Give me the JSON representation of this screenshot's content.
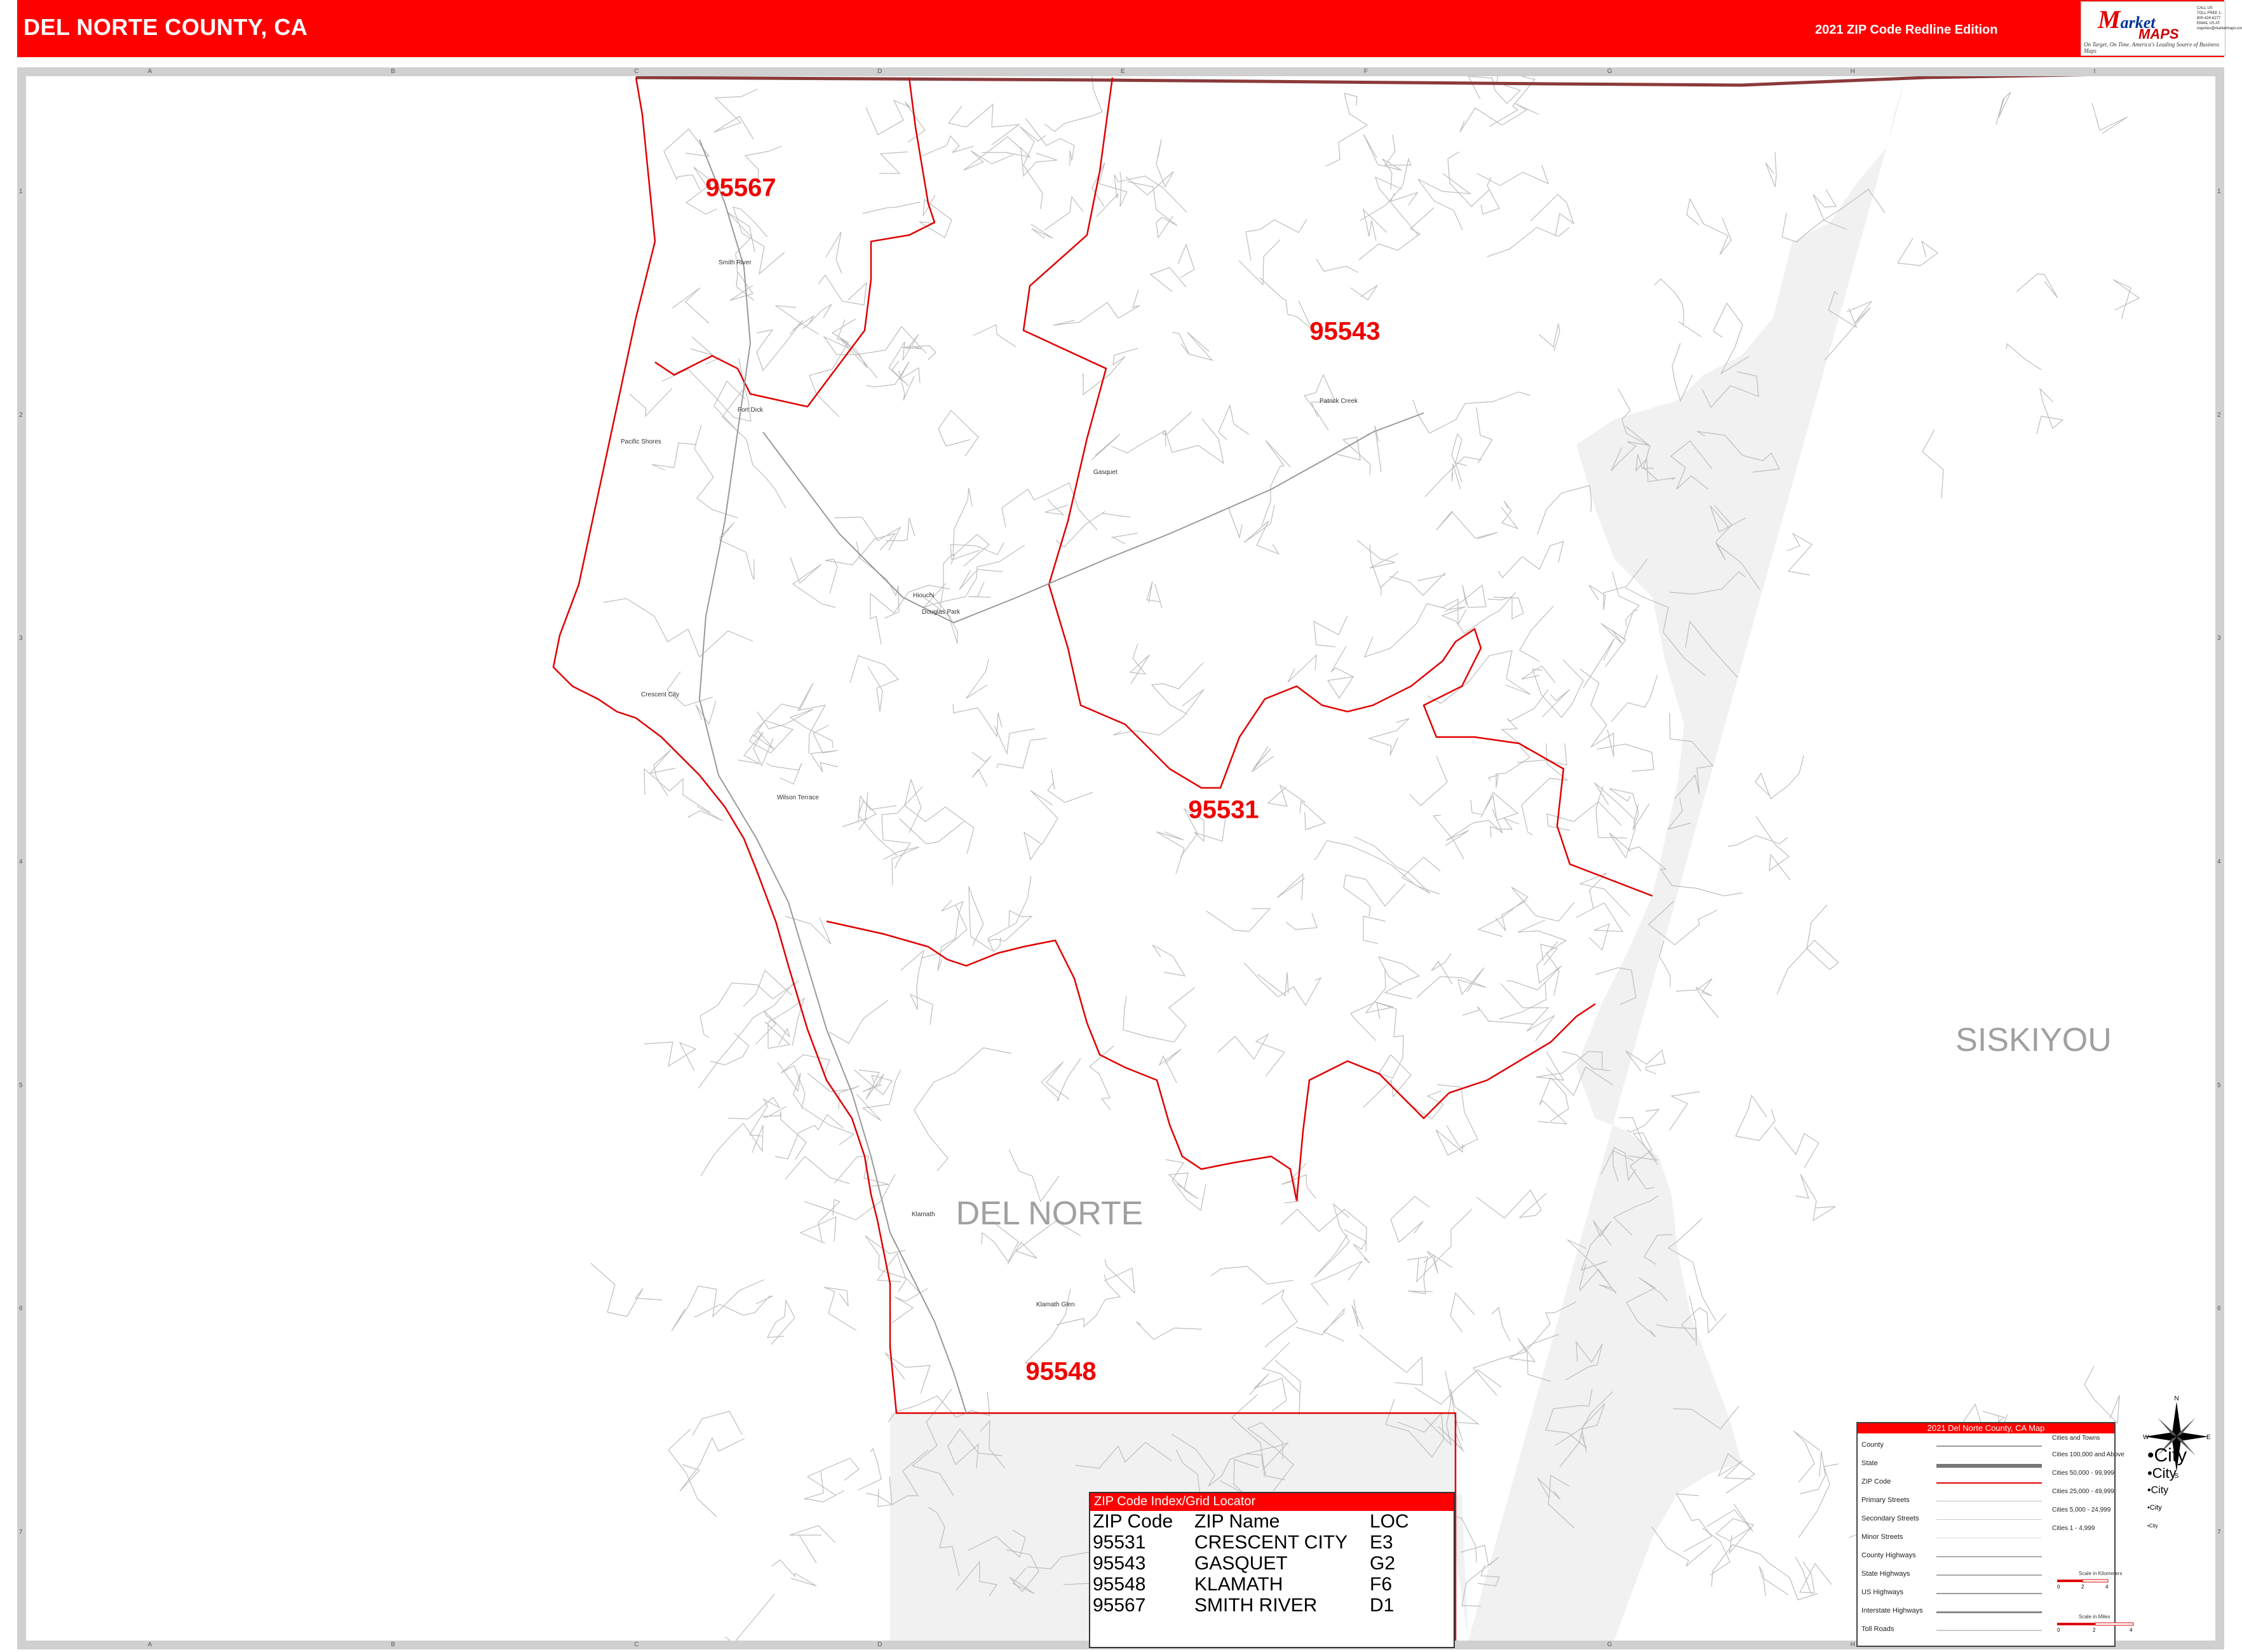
{
  "header": {
    "title": "DEL NORTE COUNTY, CA",
    "edition": "2021 ZIP Code Redline Edition"
  },
  "logo": {
    "brand_initial": "M",
    "brand_line1": "arket",
    "brand_line2": "MAPS",
    "tagline": "On Target, On Time. America's Leading Source of Business Maps",
    "contact": "CALL US TOLL FREE 1-800-424-6277 EMAIL US AT inquiries@marketmaps.com"
  },
  "grid": {
    "columns": [
      "A",
      "B",
      "C",
      "D",
      "E",
      "F",
      "G",
      "H",
      "I"
    ],
    "rows": [
      "1",
      "2",
      "3",
      "4",
      "5",
      "6",
      "7"
    ]
  },
  "zip_labels": [
    {
      "zip": "95567",
      "name": "SMITH RIVER"
    },
    {
      "zip": "95543",
      "name": "GASQUET"
    },
    {
      "zip": "95531",
      "name": "CRESCENT CITY"
    },
    {
      "zip": "95548",
      "name": "KLAMATH"
    }
  ],
  "county_labels": {
    "home": "DEL NORTE",
    "neighbor": "SISKIYOU"
  },
  "cities": [
    {
      "name": "Smith River"
    },
    {
      "name": "Fort Dick"
    },
    {
      "name": "Pacific Shores"
    },
    {
      "name": "Crescent City"
    },
    {
      "name": "Gasquet"
    },
    {
      "name": "Patrick Creek"
    },
    {
      "name": "Hiouchi"
    },
    {
      "name": "Douglas Park"
    },
    {
      "name": "Klamath"
    },
    {
      "name": "Klamath Glen"
    },
    {
      "name": "Wilson Terrace"
    }
  ],
  "zip_index": {
    "title": "ZIP Code Index/Grid Locator",
    "headers": [
      "ZIP Code",
      "ZIP Name",
      "LOC"
    ],
    "rows": [
      [
        "95531",
        "CRESCENT CITY",
        "E3"
      ],
      [
        "95543",
        "GASQUET",
        "G2"
      ],
      [
        "95548",
        "KLAMATH",
        "F6"
      ],
      [
        "95567",
        "SMITH RIVER",
        "D1"
      ]
    ]
  },
  "legend": {
    "title": "2021 Del Norte County, CA Map",
    "items": [
      "County",
      "State",
      "ZIP Code",
      "Primary Streets",
      "Secondary Streets",
      "Minor Streets",
      "County Highways",
      "State Highways",
      "US Highways",
      "Interstate Highways",
      "Toll Roads"
    ],
    "cities_heading": "Cities and Towns",
    "city_classes": [
      {
        "range": "Cities 100,000 and Above",
        "sample": "City"
      },
      {
        "range": "Cities 50,000 - 99,999",
        "sample": "City"
      },
      {
        "range": "Cities 25,000 - 49,999",
        "sample": "City"
      },
      {
        "range": "Cities 5,000 - 24,999",
        "sample": "City"
      },
      {
        "range": "Cities 1 - 4,999",
        "sample": "City"
      }
    ],
    "scale_km": "Scale in Kilometers",
    "scale_mi": "Scale in Miles",
    "scale_km_ticks": [
      "0",
      "2",
      "4"
    ],
    "scale_mi_ticks": [
      "0",
      "2",
      "4"
    ]
  },
  "compass": {
    "n": "N",
    "s": "S",
    "e": "E",
    "w": "W"
  },
  "colors": {
    "brand_red": "#ff0000",
    "zip_boundary": "#e00000",
    "state_boundary": "#8b3a3a",
    "outside_county": "#f2f2f2",
    "roads": "#b8b8b8"
  }
}
